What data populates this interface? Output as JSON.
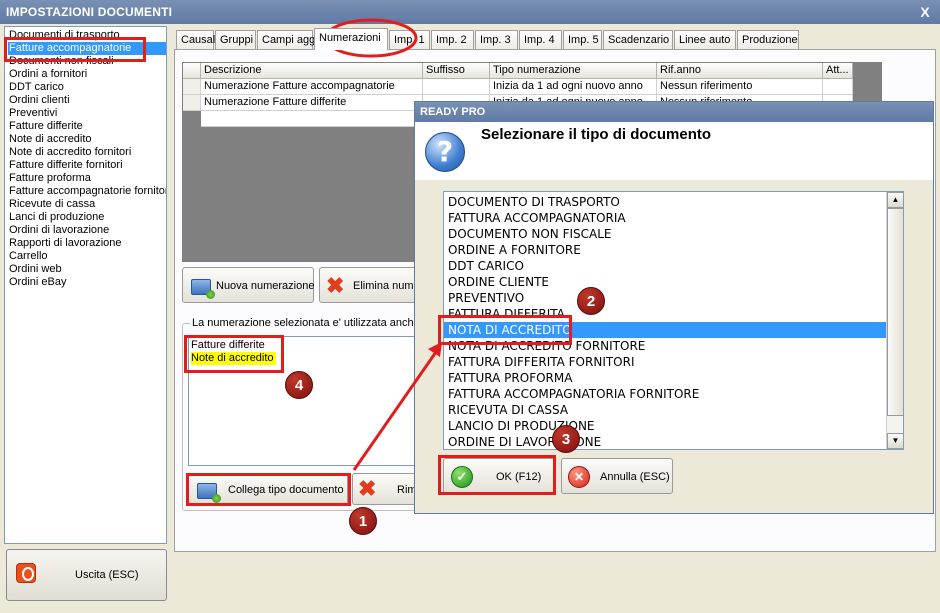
{
  "window": {
    "title": "IMPOSTAZIONI DOCUMENTI",
    "close_glyph": "X"
  },
  "left_list": [
    "Documenti di trasporto",
    "Fatture accompagnatorie",
    "Documenti non fiscali",
    "Ordini a fornitori",
    "DDT carico",
    "Ordini clienti",
    "Preventivi",
    "Fatture differite",
    "Note di accredito",
    "Note di accredito fornitori",
    "Fatture differite fornitori",
    "Fatture proforma",
    "Fatture accompagnatorie fornitori",
    "Ricevute di cassa",
    "Lanci di produzione",
    "Ordini di lavorazione",
    "Rapporti di lavorazione",
    "Carrello",
    "Ordini web",
    "Ordini eBay"
  ],
  "left_selected_index": 1,
  "exit_button": {
    "label": "Uscita (ESC)",
    "icon": "power-icon"
  },
  "tabs": [
    "Causali",
    "Gruppi",
    "Campi agg.",
    "Numerazioni",
    "Imp. 1",
    "Imp. 2",
    "Imp. 3",
    "Imp. 4",
    "Imp. 5",
    "Scadenzario",
    "Linee auto",
    "Produzione"
  ],
  "active_tab": "Numerazioni",
  "grid": {
    "columns": [
      "Descrizione",
      "Suffisso",
      "Tipo numerazione",
      "Rif.anno",
      "Att..."
    ],
    "rows": [
      [
        "Numerazione Fatture accompagnatorie",
        "",
        "Inizia da 1 ad ogni nuovo anno",
        "Nessun riferimento",
        ""
      ],
      [
        "Numerazione Fatture differite",
        "",
        "Inizia da 1 ad ogni nuovo anno",
        "Nessun riferimento",
        ""
      ]
    ]
  },
  "buttons": {
    "new_numbering": "Nuova numerazione",
    "delete_numbering": "Elimina numerazione",
    "link_doc_type": "Collega tipo documento",
    "remove": "Rimuovi"
  },
  "linked_group": {
    "label": "La numerazione selezionata e' utilizzata anche",
    "items": [
      "Fatture differite",
      "Note di accredito"
    ]
  },
  "dialog": {
    "title": "READY PRO",
    "prompt": "Selezionare il tipo di documento",
    "icon": "question-icon",
    "items": [
      "DOCUMENTO DI TRASPORTO",
      "FATTURA ACCOMPAGNATORIA",
      "DOCUMENTO NON FISCALE",
      "ORDINE A FORNITORE",
      "DDT CARICO",
      "ORDINE CLIENTE",
      "PREVENTIVO",
      "FATTURA DIFFERITA",
      "NOTA DI ACCREDITO",
      "NOTA DI ACCREDITO FORNITORE",
      "FATTURA DIFFERITA FORNITORI",
      "FATTURA PROFORMA",
      "FATTURA ACCOMPAGNATORIA FORNITORE",
      "RICEVUTA DI CASSA",
      "LANCIO DI PRODUZIONE",
      "ORDINE DI LAVORAZIONE"
    ],
    "selected_index": 8,
    "ok_label": "OK (F12)",
    "cancel_label": "Annulla (ESC)"
  },
  "markers": [
    "1",
    "2",
    "3",
    "4"
  ],
  "colors": {
    "selection": "#3399ff",
    "highlight": "#ffff00",
    "annotation": "#e21d1d",
    "title_bar": "#6a84ad"
  }
}
